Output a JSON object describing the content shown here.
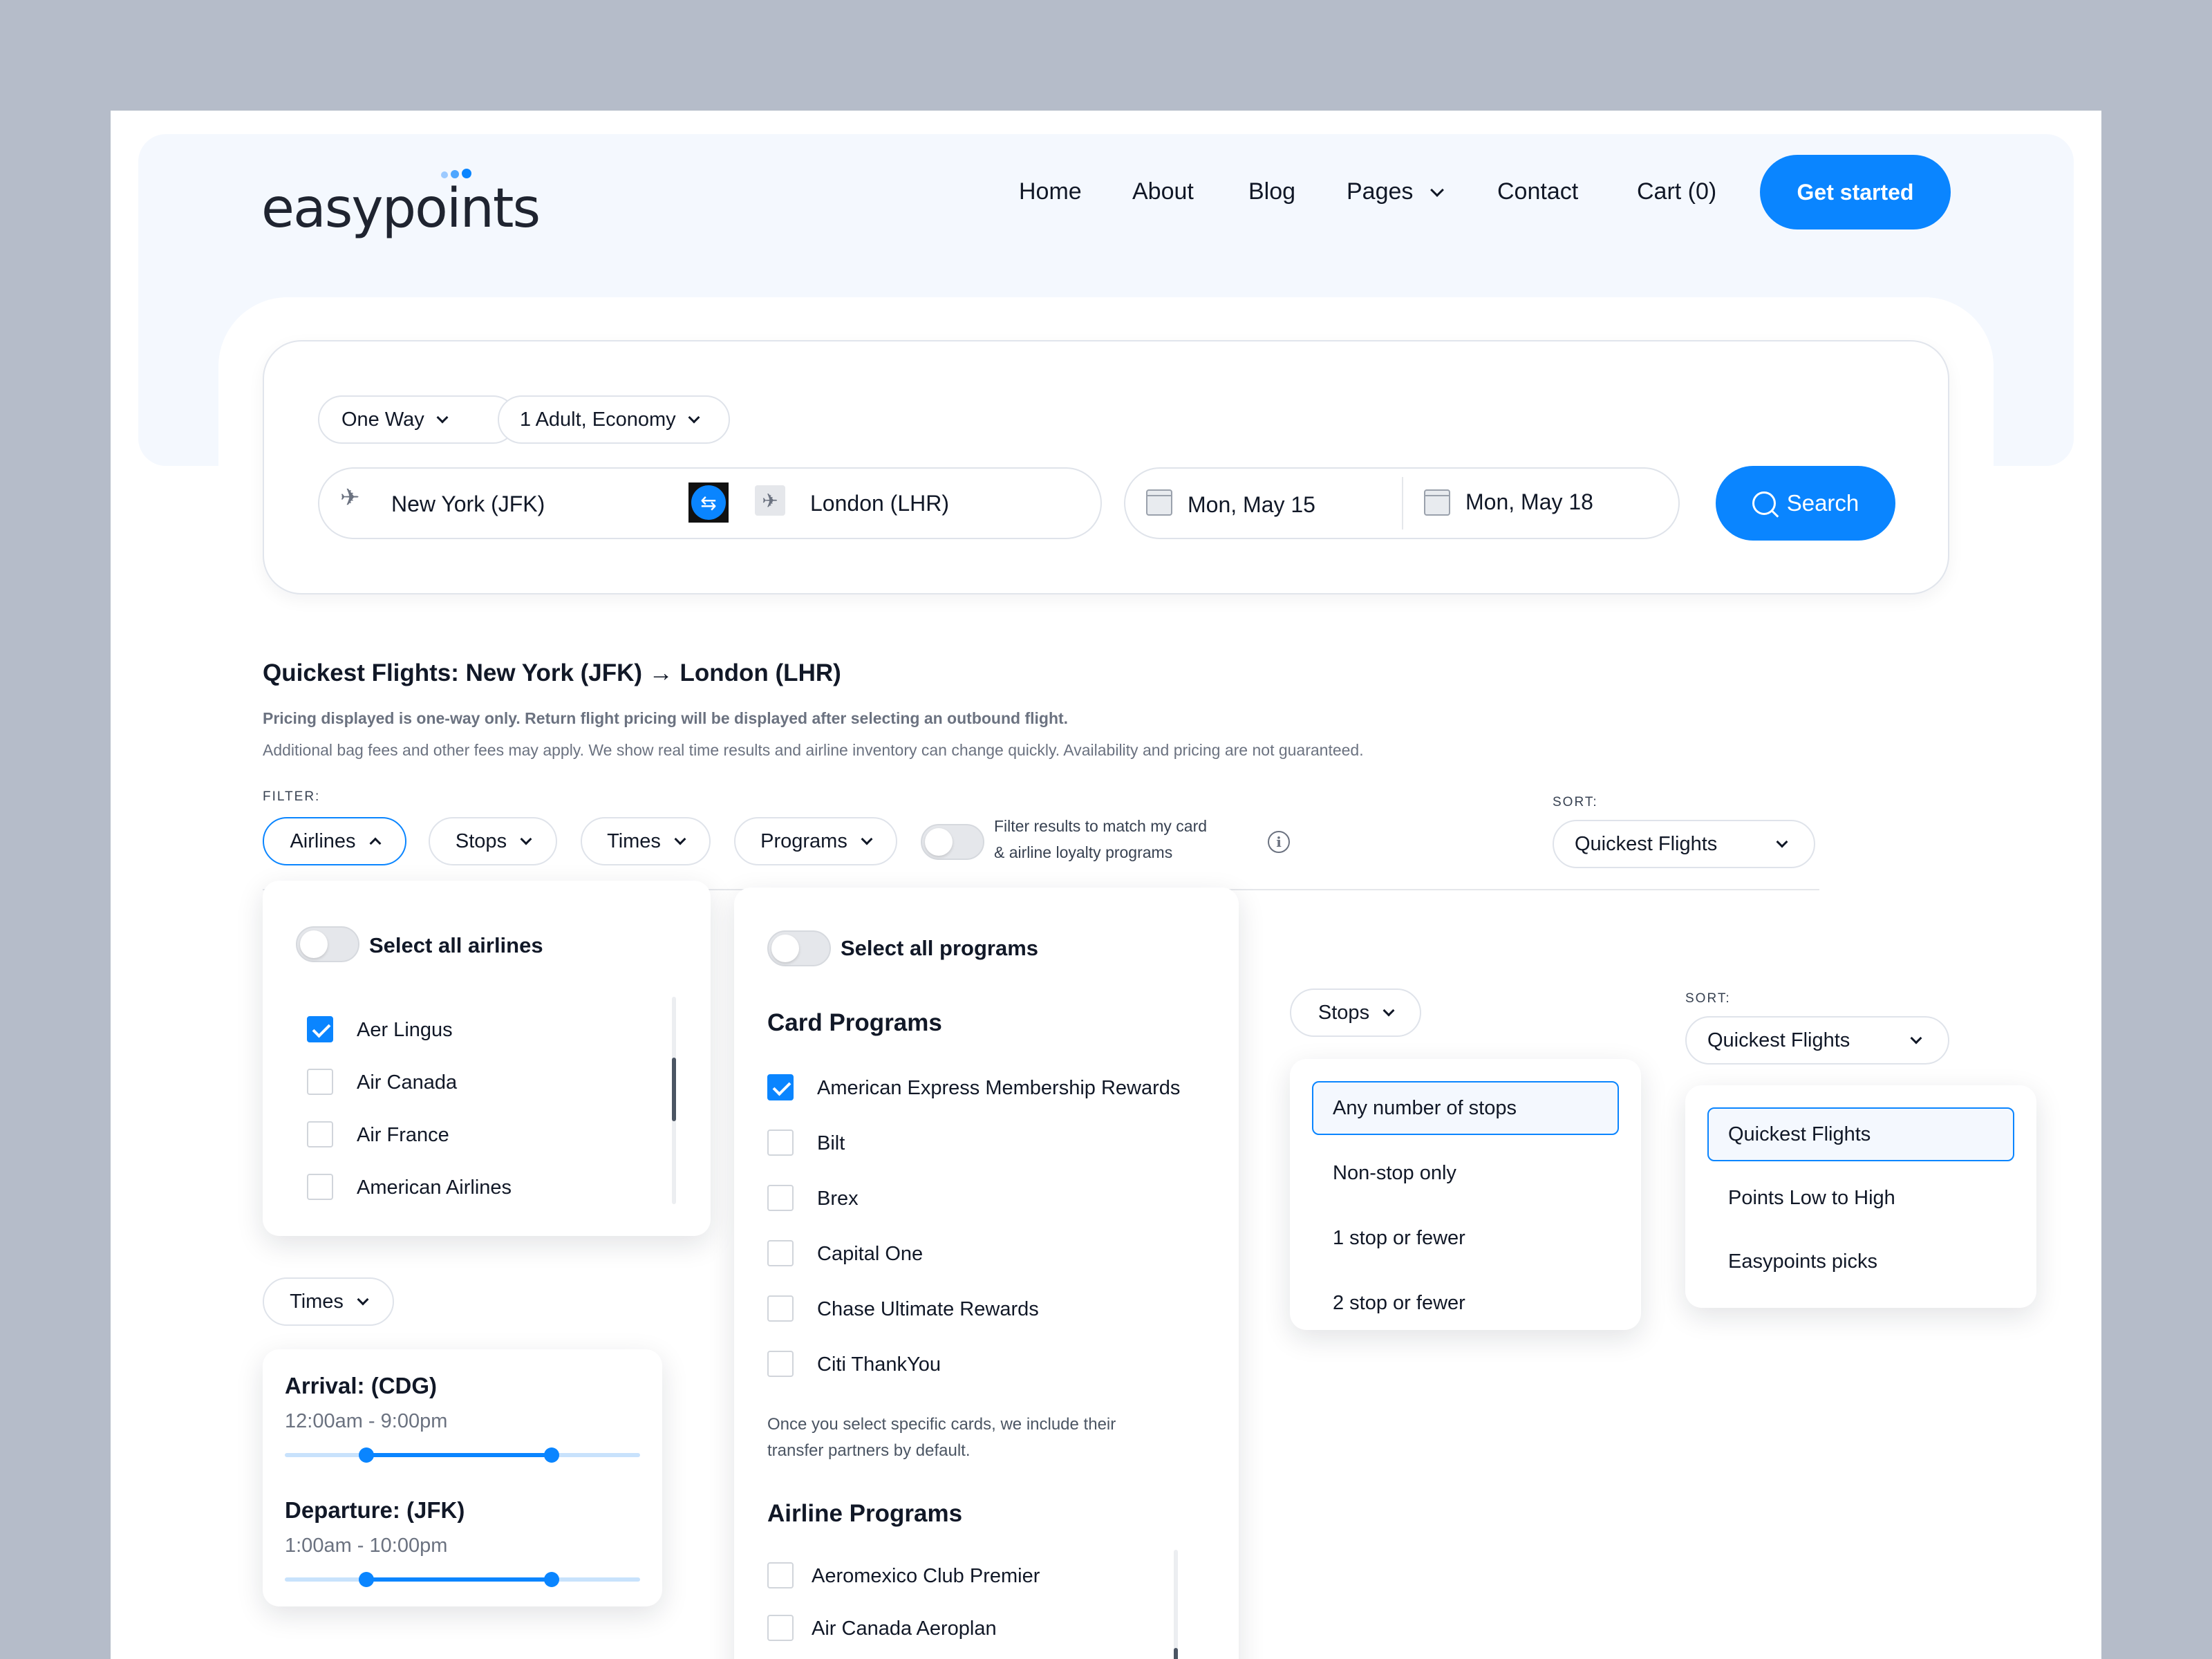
{
  "brand": {
    "name": "easypoints",
    "accent": "#0a85ff"
  },
  "nav": {
    "items": [
      "Home",
      "About",
      "Blog",
      "Pages",
      "Contact",
      "Cart (0)"
    ],
    "cta": "Get started"
  },
  "search": {
    "trip_type": "One Way",
    "passengers": "1 Adult, Economy",
    "from": "New York (JFK)",
    "to": "London (LHR)",
    "depart_date": "Mon, May 15",
    "return_date": "Mon, May 18",
    "button": "Search"
  },
  "results": {
    "title": "Quickest Flights:  New York (JFK)  → London (LHR)",
    "note_bold": "Pricing displayed is one-way only. Return flight pricing will be displayed after selecting an outbound flight.",
    "note": "Additional bag fees and other fees may apply. We show real time results and airline inventory can change quickly. Availability and pricing are not guaranteed."
  },
  "filters": {
    "label": "FILTER:",
    "airlines": "Airlines",
    "stops": "Stops",
    "times": "Times",
    "programs": "Programs",
    "match_toggle_line1": "Filter results to match my card",
    "match_toggle_line2": "& airline loyalty programs",
    "sort_label": "SORT:",
    "sort_value": "Quickest Flights"
  },
  "airlines_panel": {
    "select_all": "Select all airlines",
    "items": [
      {
        "label": "Aer Lingus",
        "checked": true
      },
      {
        "label": "Air Canada",
        "checked": false
      },
      {
        "label": "Air France",
        "checked": false
      },
      {
        "label": "American Airlines",
        "checked": false
      }
    ]
  },
  "programs_panel": {
    "select_all": "Select all programs",
    "card_heading": "Card Programs",
    "card_items": [
      {
        "label": "American Express Membership Rewards",
        "checked": true
      },
      {
        "label": "Bilt",
        "checked": false
      },
      {
        "label": "Brex",
        "checked": false
      },
      {
        "label": "Capital One",
        "checked": false
      },
      {
        "label": "Chase Ultimate Rewards",
        "checked": false
      },
      {
        "label": "Citi ThankYou",
        "checked": false
      }
    ],
    "note_line1": "Once you select specific cards, we include their",
    "note_line2": "transfer partners by default.",
    "airline_heading": "Airline Programs",
    "airline_items": [
      {
        "label": "Aeromexico Club Premier",
        "checked": false
      },
      {
        "label": "Air Canada Aeroplan",
        "checked": false
      }
    ]
  },
  "stops_panel": {
    "button": "Stops",
    "options": [
      "Any number of stops",
      "Non-stop only",
      "1 stop or fewer",
      "2 stop or fewer"
    ],
    "selected": 0
  },
  "sort_panel": {
    "label": "SORT:",
    "button": "Quickest Flights",
    "options": [
      "Quickest Flights",
      "Points Low to High",
      "Easypoints picks"
    ],
    "selected": 0
  },
  "times_panel": {
    "button": "Times",
    "arrival_title": "Arrival: (CDG)",
    "arrival_range": "12:00am - 9:00pm",
    "arrival_slider": [
      0.23,
      0.75
    ],
    "departure_title": "Departure: (JFK)",
    "departure_range": "1:00am - 10:00pm",
    "departure_slider": [
      0.23,
      0.75
    ]
  }
}
